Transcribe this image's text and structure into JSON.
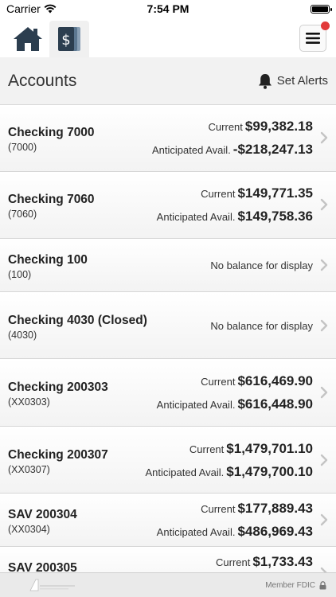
{
  "status": {
    "carrier": "Carrier",
    "time": "7:54 PM"
  },
  "header": {
    "title": "Accounts",
    "alerts_label": "Set Alerts"
  },
  "rows": [
    {
      "name": "Checking 7000",
      "number": "(7000)",
      "current_label": "Current",
      "current": "$99,382.18",
      "avail_label": "Anticipated Avail.",
      "avail": "-$218,247.13"
    },
    {
      "name": "Checking 7060",
      "number": "(7060)",
      "current_label": "Current",
      "current": "$149,771.35",
      "avail_label": "Anticipated Avail.",
      "avail": "$149,758.36"
    },
    {
      "name": "Checking 100",
      "number": "(100)",
      "no_balance": "No balance for display"
    },
    {
      "name": "Checking 4030 (Closed)",
      "number": "(4030)",
      "no_balance": "No balance for display"
    },
    {
      "name": "Checking 200303",
      "number": "(XX0303)",
      "current_label": "Current",
      "current": "$616,469.90",
      "avail_label": "Anticipated Avail.",
      "avail": "$616,448.90"
    },
    {
      "name": "Checking 200307",
      "number": "(XX0307)",
      "current_label": "Current",
      "current": "$1,479,701.10",
      "avail_label": "Anticipated Avail.",
      "avail": "$1,479,700.10"
    },
    {
      "name": "SAV 200304",
      "number": "(XX0304)",
      "current_label": "Current",
      "current": "$177,889.43",
      "avail_label": "Anticipated Avail.",
      "avail": "$486,969.43"
    },
    {
      "name": "SAV 200305",
      "current_label": "Current",
      "current": "$1,733.43"
    }
  ],
  "footer": {
    "member": "Member FDIC"
  },
  "colors": {
    "header_bg": "#f2f2f2",
    "nav_icon": "#2c3e4f",
    "notification": "#e23a3a",
    "chevron": "#c4c4c4"
  },
  "icons": [
    "home-icon",
    "accounts-icon",
    "menu-icon",
    "bell-icon",
    "chevron-right-icon",
    "lock-icon",
    "bank-logo"
  ]
}
